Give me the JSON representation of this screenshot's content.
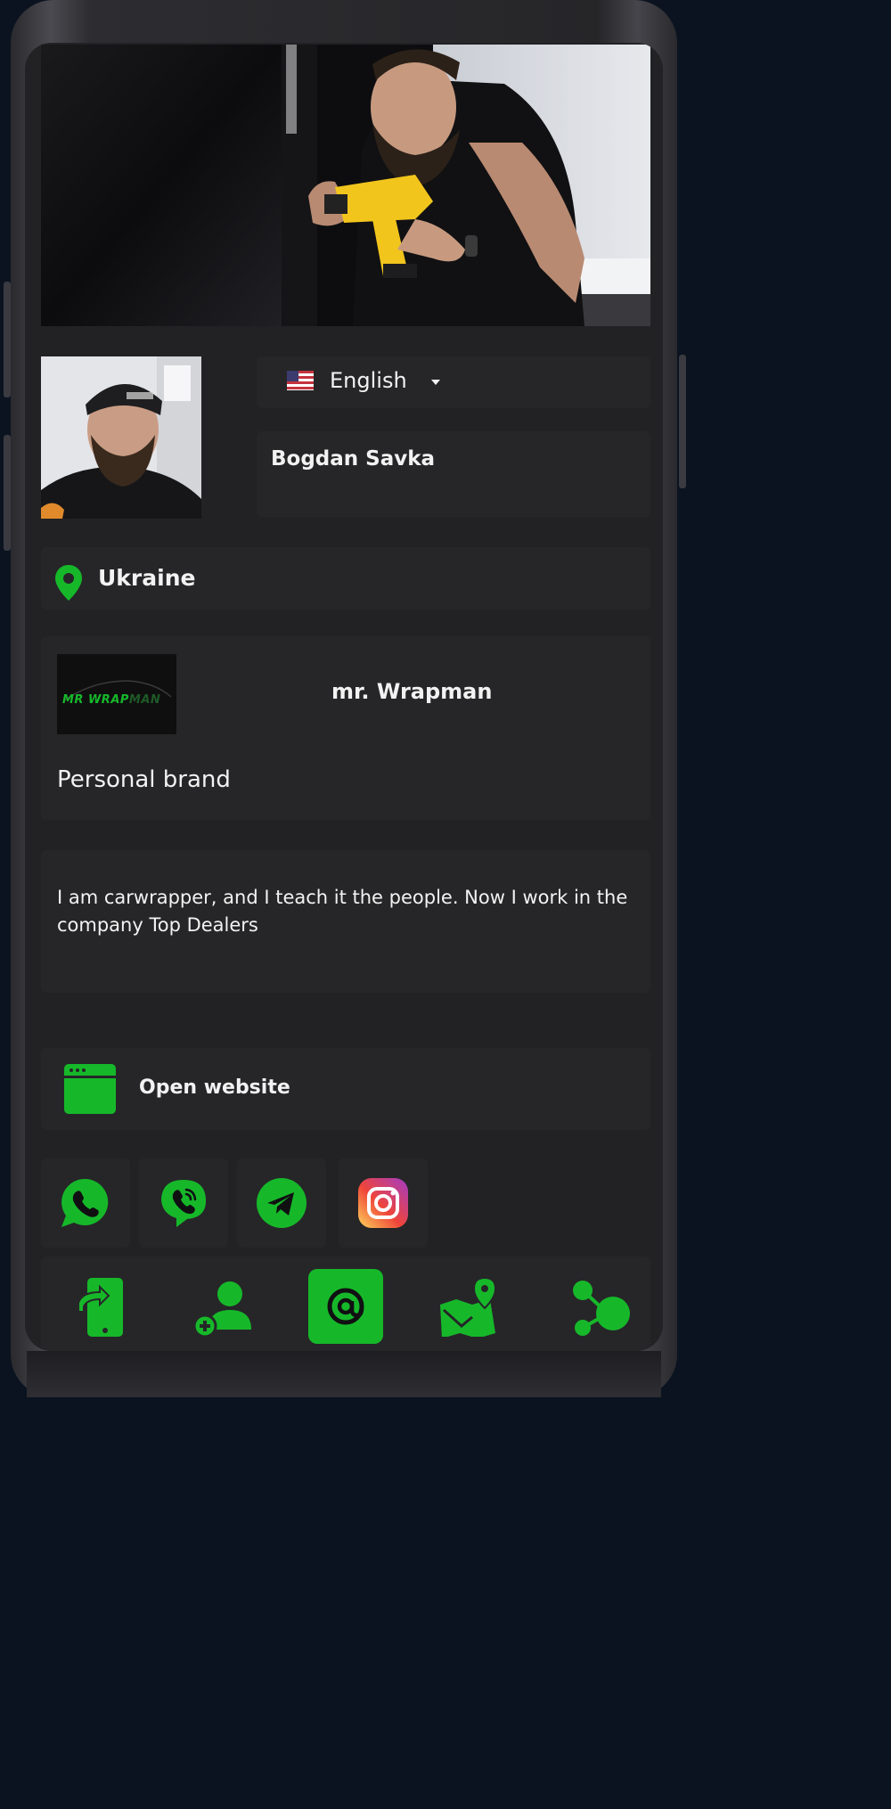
{
  "header": {
    "language": "English"
  },
  "profile": {
    "name": "Bogdan Savka",
    "location": "Ukraine"
  },
  "brand": {
    "logo_text_a": "MR WRAP",
    "logo_text_b": "MAN",
    "name": "mr. Wrapman",
    "tagline": "Personal brand"
  },
  "about": {
    "text": "I am carwrapper, and I teach it the people. Now I work in the company Top Dealers"
  },
  "website": {
    "label": "Open website"
  },
  "social": [
    "whatsapp-icon",
    "viber-icon",
    "telegram-icon",
    "instagram-icon"
  ],
  "bottom_nav": [
    "share-contact-icon",
    "add-contact-icon",
    "email-icon",
    "map-location-icon",
    "share-network-icon"
  ],
  "colors": {
    "accent": "#16b82a",
    "card": "#262628",
    "screen": "#222224"
  }
}
